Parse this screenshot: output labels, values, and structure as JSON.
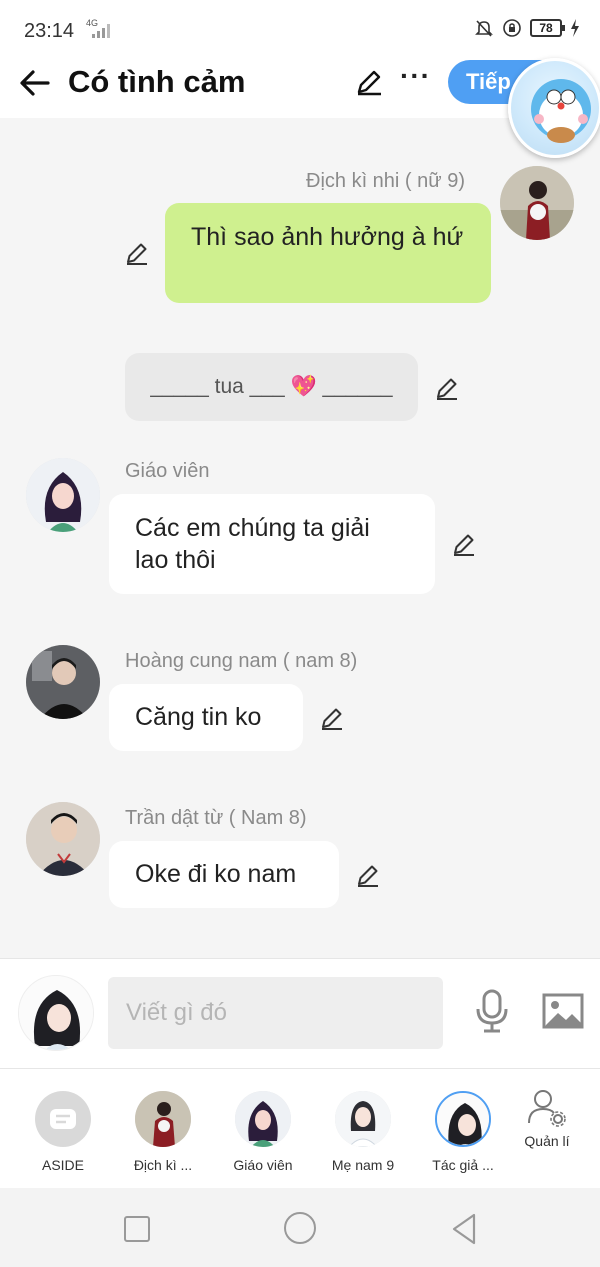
{
  "status_bar": {
    "time": "23:14",
    "network": "4G",
    "battery": "78"
  },
  "header": {
    "title": "Có tình cảm",
    "next_label": "Tiếp"
  },
  "messages": [
    {
      "speaker": "Địch kì nhi ( nữ 9)",
      "text": "Thì sao ảnh hưởng à hứ"
    },
    {
      "text": "_____ tua ___ 💖 ______"
    },
    {
      "speaker": "Giáo viên",
      "text": "Các em chúng ta giải lao thôi"
    },
    {
      "speaker": "Hoàng cung nam ( nam 8)",
      "text": "Căng tin ko"
    },
    {
      "speaker": "Trần dật từ ( Nam 8)",
      "text": "Oke đi ko nam"
    }
  ],
  "compose": {
    "placeholder": "Viết gì đó"
  },
  "characters": [
    {
      "label": "ASIDE"
    },
    {
      "label": "Địch kì ..."
    },
    {
      "label": "Giáo viên"
    },
    {
      "label": "Mẹ nam 9"
    },
    {
      "label": "Tác giả ..."
    }
  ],
  "manage_label": "Quản lí",
  "colors": {
    "accent": "#4f9ff3",
    "my_bubble": "#cff08f",
    "background": "#f5f5f5"
  }
}
